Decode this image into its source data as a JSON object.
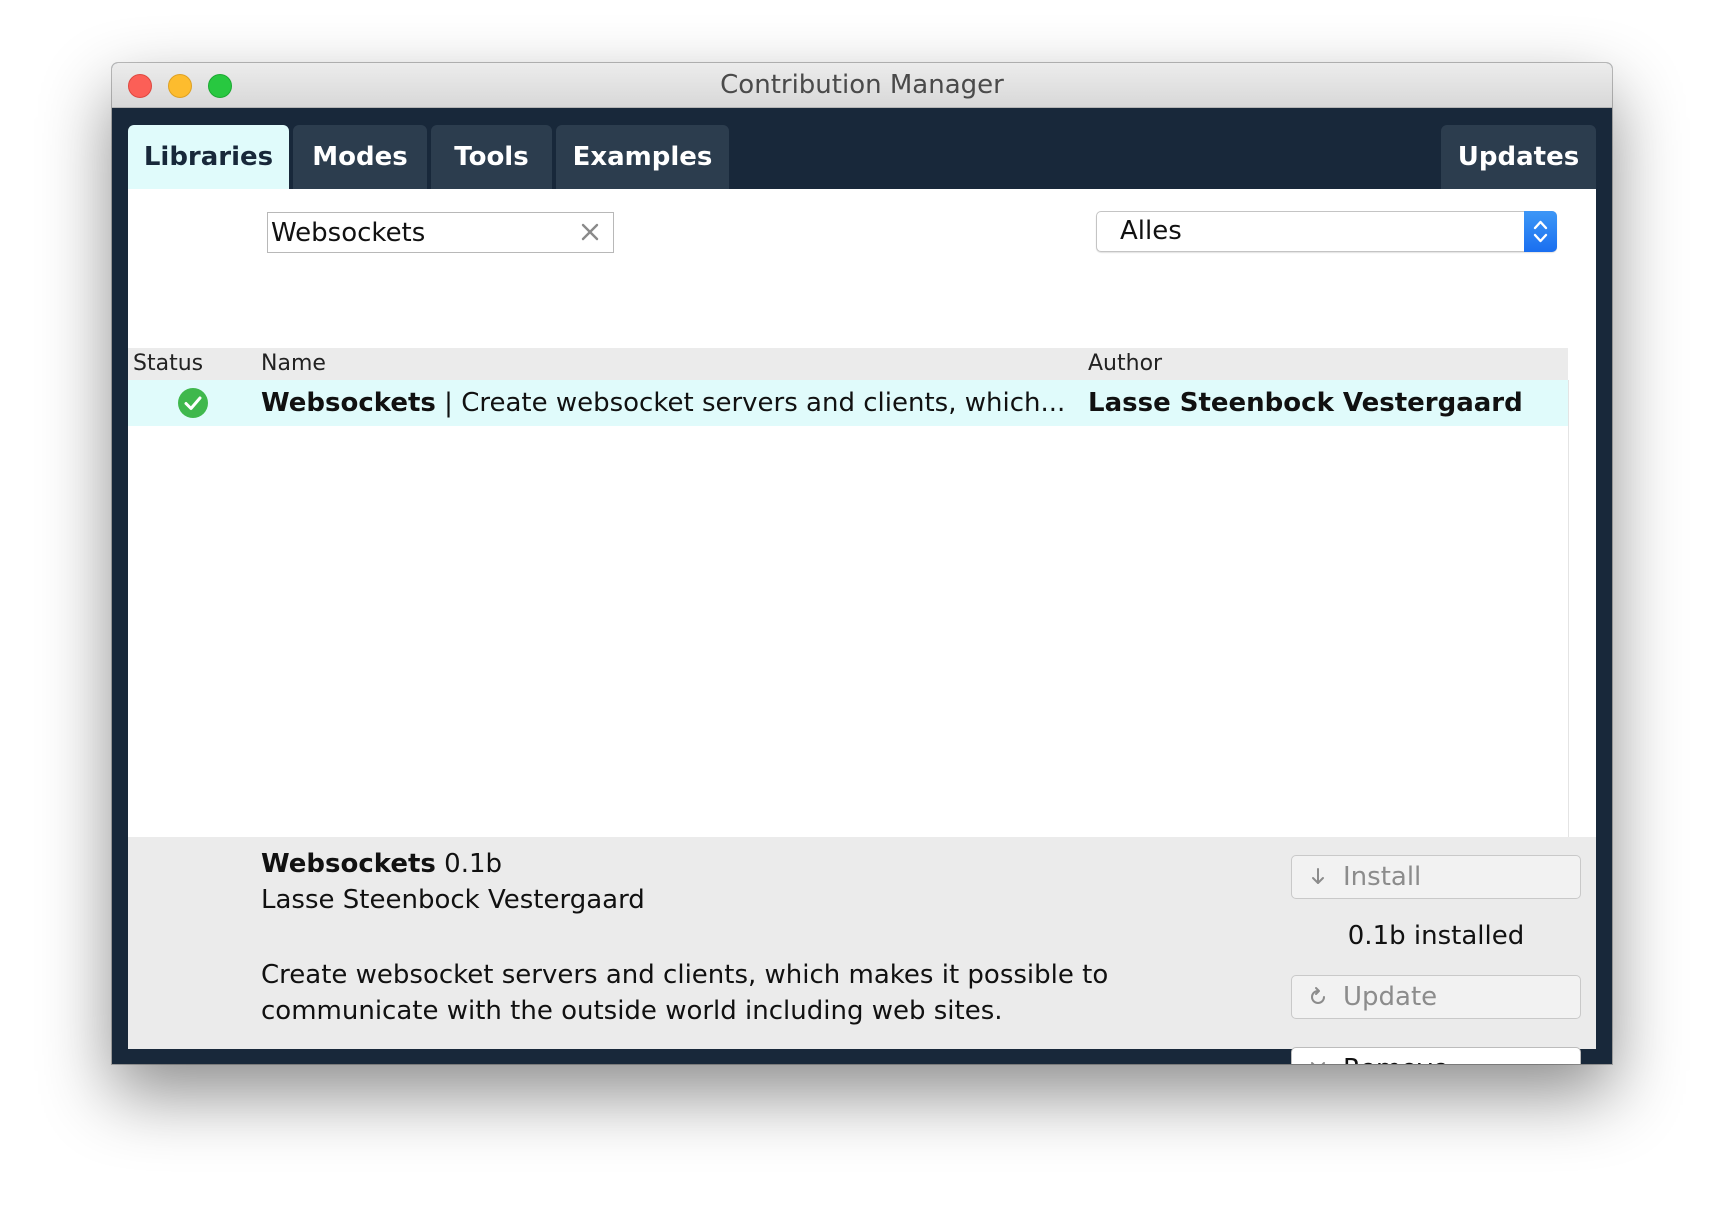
{
  "window": {
    "title": "Contribution Manager"
  },
  "tabs": [
    {
      "label": "Libraries",
      "active": true
    },
    {
      "label": "Modes",
      "active": false
    },
    {
      "label": "Tools",
      "active": false
    },
    {
      "label": "Examples",
      "active": false
    },
    {
      "label": "Updates",
      "active": false
    }
  ],
  "search": {
    "value": "Websockets",
    "clear_icon": "close-icon"
  },
  "filter": {
    "selected": "Alles",
    "icon": "updown-chevron-icon"
  },
  "table": {
    "columns": [
      "Status",
      "Name",
      "Author"
    ],
    "rows": [
      {
        "status_icon": "check-circle-icon",
        "name": "Websockets",
        "separator": " | ",
        "summary": "Create websocket servers and clients, which...",
        "author": "Lasse Steenbock Vestergaard"
      }
    ]
  },
  "details": {
    "name": "Websockets",
    "version": "0.1b",
    "author": "Lasse Steenbock Vestergaard",
    "description": "Create websocket servers and clients, which makes it possible to communicate with the outside world including web sites.",
    "installed_text": "0.1b installed",
    "buttons": {
      "install": "Install",
      "update": "Update",
      "remove": "Remove"
    }
  },
  "colors": {
    "window_bg": "#18283a",
    "tab_bg": "#2c3d4e",
    "active_tab_bg": "#e0fbfb",
    "selected_row_bg": "#e0fbfb",
    "check_green": "#3fb84d",
    "select_blue": "#1a6ff0"
  }
}
